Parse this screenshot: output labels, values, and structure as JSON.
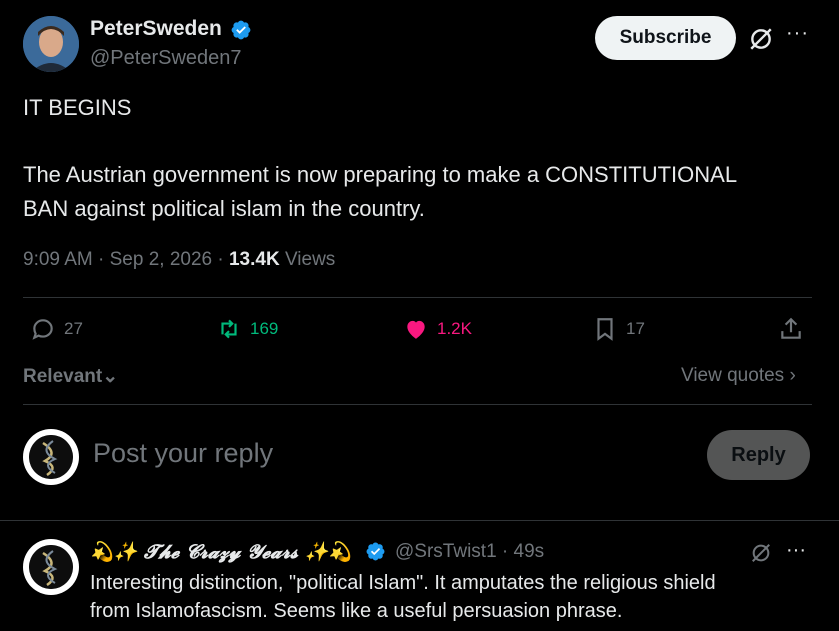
{
  "author": {
    "name": "PeterSweden",
    "handle": "@PeterSweden7"
  },
  "header": {
    "subscribe_label": "Subscribe",
    "more_label": "···"
  },
  "tweet": {
    "line1": "IT BEGINS",
    "line2": "The Austrian government is now preparing to make a CONSTITUTIONAL",
    "line3": "BAN against political islam in the country."
  },
  "meta": {
    "time": "9:09 AM",
    "sep1": " · ",
    "date": "Sep 2, 2026",
    "sep2": " · ",
    "views_count": "13.4K",
    "views_label": " Views"
  },
  "actions": {
    "replies": "27",
    "reposts": "169",
    "likes": "1.2K",
    "bookmarks": "17"
  },
  "colors": {
    "repost": "#00ba7c",
    "like": "#f91880",
    "verified": "#1d9bf0"
  },
  "sort": {
    "relevant_label": "Relevant",
    "view_quotes_label": "View quotes"
  },
  "composer": {
    "placeholder": "Post your reply",
    "reply_label": "Reply"
  },
  "comment": {
    "name": "💫✨ 𝓣𝓱𝓮 𝓒𝓻𝓪𝔃𝔂 𝓨𝓮𝓪𝓻𝓼 ✨💫",
    "handle": "@SrsTwist1",
    "time": " · 49s",
    "line1": "Interesting distinction, \"political Islam\". It amputates the religious shield",
    "line2": "from Islamofascism. Seems like a useful persuasion phrase.",
    "more_label": "···"
  }
}
